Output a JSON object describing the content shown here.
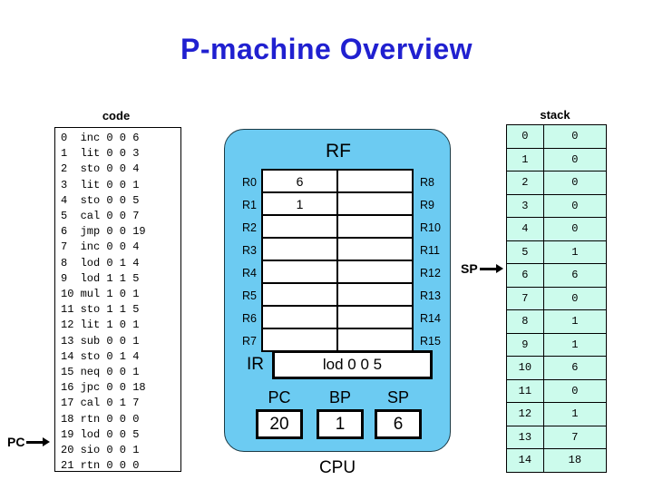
{
  "title": "P-machine Overview",
  "code_panel": {
    "caption": "code",
    "pointer": {
      "label": "PC",
      "target_index": 20
    },
    "instructions": [
      {
        "idx": "0",
        "op": "inc",
        "a": "0",
        "b": "0",
        "c": "6"
      },
      {
        "idx": "1",
        "op": "lit",
        "a": "0",
        "b": "0",
        "c": "3"
      },
      {
        "idx": "2",
        "op": "sto",
        "a": "0",
        "b": "0",
        "c": "4"
      },
      {
        "idx": "3",
        "op": "lit",
        "a": "0",
        "b": "0",
        "c": "1"
      },
      {
        "idx": "4",
        "op": "sto",
        "a": "0",
        "b": "0",
        "c": "5"
      },
      {
        "idx": "5",
        "op": "cal",
        "a": "0",
        "b": "0",
        "c": "7"
      },
      {
        "idx": "6",
        "op": "jmp",
        "a": "0",
        "b": "0",
        "c": "19"
      },
      {
        "idx": "7",
        "op": "inc",
        "a": "0",
        "b": "0",
        "c": "4"
      },
      {
        "idx": "8",
        "op": "lod",
        "a": "0",
        "b": "1",
        "c": "4"
      },
      {
        "idx": "9",
        "op": "lod",
        "a": "1",
        "b": "1",
        "c": "5"
      },
      {
        "idx": "10",
        "op": "mul",
        "a": "1",
        "b": "0",
        "c": "1"
      },
      {
        "idx": "11",
        "op": "sto",
        "a": "1",
        "b": "1",
        "c": "5"
      },
      {
        "idx": "12",
        "op": "lit",
        "a": "1",
        "b": "0",
        "c": "1"
      },
      {
        "idx": "13",
        "op": "sub",
        "a": "0",
        "b": "0",
        "c": "1"
      },
      {
        "idx": "14",
        "op": "sto",
        "a": "0",
        "b": "1",
        "c": "4"
      },
      {
        "idx": "15",
        "op": "neq",
        "a": "0",
        "b": "0",
        "c": "1"
      },
      {
        "idx": "16",
        "op": "jpc",
        "a": "0",
        "b": "0",
        "c": "18"
      },
      {
        "idx": "17",
        "op": "cal",
        "a": "0",
        "b": "1",
        "c": "7"
      },
      {
        "idx": "18",
        "op": "rtn",
        "a": "0",
        "b": "0",
        "c": "0"
      },
      {
        "idx": "19",
        "op": "lod",
        "a": "0",
        "b": "0",
        "c": "5"
      },
      {
        "idx": "20",
        "op": "sio",
        "a": "0",
        "b": "0",
        "c": "1"
      },
      {
        "idx": "21",
        "op": "rtn",
        "a": "0",
        "b": "0",
        "c": "0"
      }
    ]
  },
  "cpu": {
    "caption": "CPU",
    "rf_title": "RF",
    "registers": [
      {
        "left_label": "R0",
        "left_value": "6",
        "right_label": "R8",
        "right_value": ""
      },
      {
        "left_label": "R1",
        "left_value": "1",
        "right_label": "R9",
        "right_value": ""
      },
      {
        "left_label": "R2",
        "left_value": "",
        "right_label": "R10",
        "right_value": ""
      },
      {
        "left_label": "R3",
        "left_value": "",
        "right_label": "R11",
        "right_value": ""
      },
      {
        "left_label": "R4",
        "left_value": "",
        "right_label": "R12",
        "right_value": ""
      },
      {
        "left_label": "R5",
        "left_value": "",
        "right_label": "R13",
        "right_value": ""
      },
      {
        "left_label": "R6",
        "left_value": "",
        "right_label": "R14",
        "right_value": ""
      },
      {
        "left_label": "R7",
        "left_value": "",
        "right_label": "R15",
        "right_value": ""
      }
    ],
    "ir": {
      "label": "IR",
      "value": "lod 0 0 5"
    },
    "pc": {
      "label": "PC",
      "value": "20"
    },
    "bp": {
      "label": "BP",
      "value": "1"
    },
    "sp": {
      "label": "SP",
      "value": "6"
    }
  },
  "stack_panel": {
    "caption": "stack",
    "pointer": {
      "label": "SP",
      "target_index": 6
    },
    "cells": [
      {
        "idx": "0",
        "value": "0"
      },
      {
        "idx": "1",
        "value": "0"
      },
      {
        "idx": "2",
        "value": "0"
      },
      {
        "idx": "3",
        "value": "0"
      },
      {
        "idx": "4",
        "value": "0"
      },
      {
        "idx": "5",
        "value": "1"
      },
      {
        "idx": "6",
        "value": "6"
      },
      {
        "idx": "7",
        "value": "0"
      },
      {
        "idx": "8",
        "value": "1"
      },
      {
        "idx": "9",
        "value": "1"
      },
      {
        "idx": "10",
        "value": "6"
      },
      {
        "idx": "11",
        "value": "0"
      },
      {
        "idx": "12",
        "value": "1"
      },
      {
        "idx": "13",
        "value": "7"
      },
      {
        "idx": "14",
        "value": "18"
      }
    ]
  },
  "colors": {
    "title": "#2020D0",
    "cpu_fill": "#6CCBF2",
    "stack_fill": "#CCFBEC",
    "border": "#000000"
  }
}
